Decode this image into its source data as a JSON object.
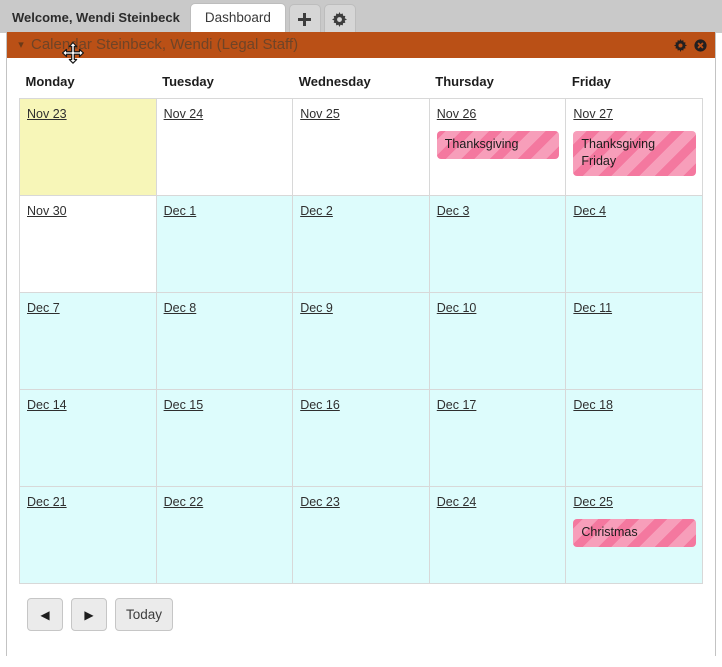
{
  "topbar": {
    "welcome": "Welcome, Wendi Steinbeck",
    "tabs": [
      {
        "label": "Dashboard",
        "active": true
      }
    ],
    "add_tab_icon": "plus-icon",
    "settings_icon": "gear-icon"
  },
  "portlet": {
    "title": "Calendar Steinbeck, Wendi (Legal Staff)",
    "collapse_icon": "chevron-down-icon",
    "settings_icon": "gear-icon",
    "close_icon": "close-icon",
    "header_color": "#ba5016",
    "title_color": "#6f4427"
  },
  "calendar": {
    "day_headers": [
      "Monday",
      "Tuesday",
      "Wednesday",
      "Thursday",
      "Friday"
    ],
    "colors": {
      "today": "#f7f6b8",
      "future": "#ddfcfc",
      "plain": "#ffffff",
      "event": "#f4789f"
    },
    "weeks": [
      [
        {
          "date": "Nov 23",
          "state": "today",
          "events": []
        },
        {
          "date": "Nov 24",
          "state": "plain",
          "events": []
        },
        {
          "date": "Nov 25",
          "state": "plain",
          "events": []
        },
        {
          "date": "Nov 26",
          "state": "plain",
          "events": [
            "Thanksgiving"
          ]
        },
        {
          "date": "Nov 27",
          "state": "plain",
          "events": [
            "Thanksgiving Friday"
          ]
        }
      ],
      [
        {
          "date": "Nov 30",
          "state": "plain",
          "events": []
        },
        {
          "date": "Dec 1",
          "state": "future",
          "events": []
        },
        {
          "date": "Dec 2",
          "state": "future",
          "events": []
        },
        {
          "date": "Dec 3",
          "state": "future",
          "events": []
        },
        {
          "date": "Dec 4",
          "state": "future",
          "events": []
        }
      ],
      [
        {
          "date": "Dec 7",
          "state": "future",
          "events": []
        },
        {
          "date": "Dec 8",
          "state": "future",
          "events": []
        },
        {
          "date": "Dec 9",
          "state": "future",
          "events": []
        },
        {
          "date": "Dec 10",
          "state": "future",
          "events": []
        },
        {
          "date": "Dec 11",
          "state": "future",
          "events": []
        }
      ],
      [
        {
          "date": "Dec 14",
          "state": "future",
          "events": []
        },
        {
          "date": "Dec 15",
          "state": "future",
          "events": []
        },
        {
          "date": "Dec 16",
          "state": "future",
          "events": []
        },
        {
          "date": "Dec 17",
          "state": "future",
          "events": []
        },
        {
          "date": "Dec 18",
          "state": "future",
          "events": []
        }
      ],
      [
        {
          "date": "Dec 21",
          "state": "future",
          "events": []
        },
        {
          "date": "Dec 22",
          "state": "future",
          "events": []
        },
        {
          "date": "Dec 23",
          "state": "future",
          "events": []
        },
        {
          "date": "Dec 24",
          "state": "future",
          "events": []
        },
        {
          "date": "Dec 25",
          "state": "future",
          "events": [
            "Christmas"
          ]
        }
      ]
    ]
  },
  "nav": {
    "prev_label": "◀",
    "next_label": "▶",
    "today_label": "Today"
  }
}
